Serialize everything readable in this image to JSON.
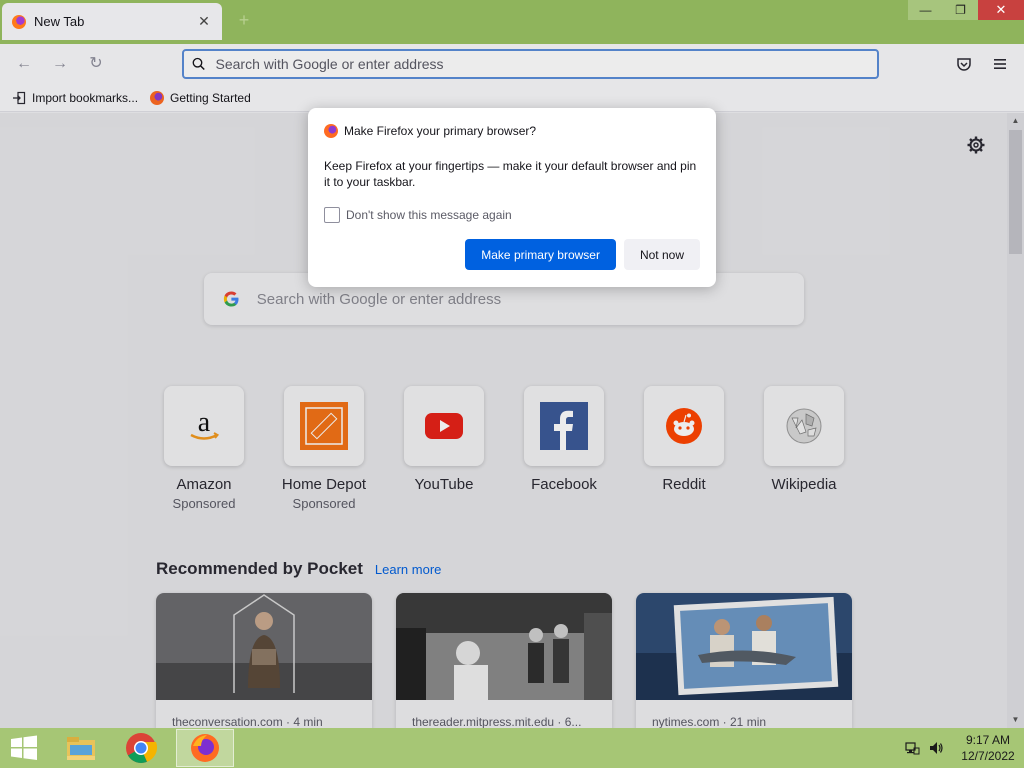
{
  "browser": {
    "tab": {
      "title": "New Tab",
      "close": "✕"
    },
    "new_tab": "+",
    "window_controls": {
      "minimize": "—",
      "restore": "❐",
      "close": "✕"
    },
    "nav": {
      "back": "←",
      "forward": "→",
      "reload": "↻"
    },
    "urlbar": {
      "placeholder": "Search with Google or enter address",
      "value": ""
    },
    "bookmarks": [
      {
        "label": "Import bookmarks...",
        "icon": "import-icon"
      },
      {
        "label": "Getting Started",
        "icon": "firefox-icon"
      }
    ]
  },
  "newtab": {
    "search": {
      "placeholder": "Search with Google or enter address"
    },
    "top_sites": [
      {
        "name": "Amazon",
        "sub": "Sponsored"
      },
      {
        "name": "Home Depot",
        "sub": "Sponsored"
      },
      {
        "name": "YouTube",
        "sub": ""
      },
      {
        "name": "Facebook",
        "sub": ""
      },
      {
        "name": "Reddit",
        "sub": ""
      },
      {
        "name": "Wikipedia",
        "sub": ""
      }
    ],
    "pocket": {
      "title": "Recommended by Pocket",
      "learn_more": "Learn more",
      "cards": [
        {
          "source": "theconversation.com · 4 min"
        },
        {
          "source": "thereader.mitpress.mit.edu · 6..."
        },
        {
          "source": "nytimes.com · 21 min"
        }
      ]
    }
  },
  "dialog": {
    "title": "Make Firefox your primary browser?",
    "body": "Keep Firefox at your fingertips — make it your default browser and pin it to your taskbar.",
    "checkbox_label": "Don't show this message again",
    "checkbox_checked": false,
    "primary_button": "Make primary browser",
    "secondary_button": "Not now"
  },
  "taskbar": {
    "time": "9:17 AM",
    "date": "12/7/2022",
    "apps": [
      "file-explorer-icon",
      "chrome-icon",
      "firefox-icon"
    ]
  },
  "colors": {
    "titlebar": "#8fb45c",
    "taskbar": "#a6c675",
    "primary_button": "#0061e0",
    "url_focus": "#5b8ed9"
  }
}
